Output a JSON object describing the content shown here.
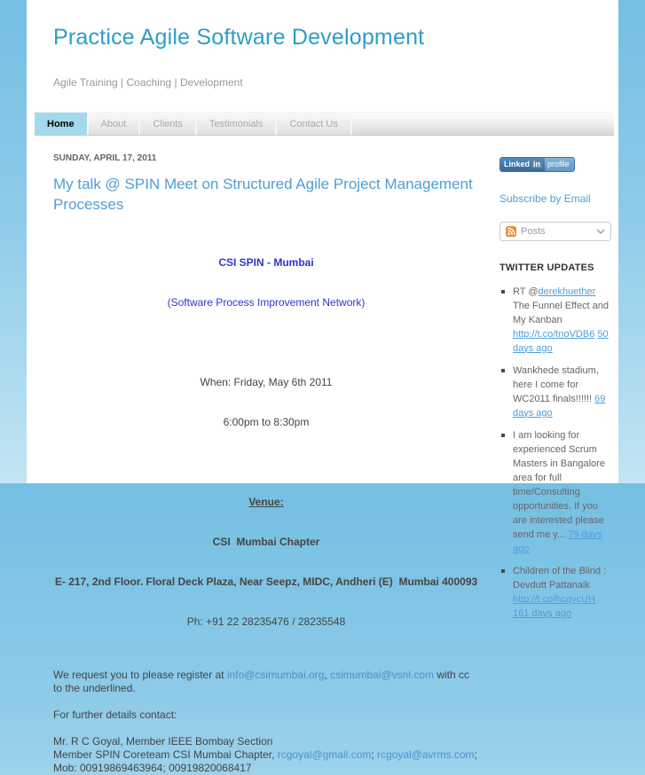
{
  "colors": {
    "page-bg-top": "#74bfe2",
    "page-bg-bottom": "#c2e5f3",
    "header-title": "#2f9dc8",
    "post-title": "#4d9fd6",
    "royal-blue": "#3036c9",
    "link-blue": "#4d8fd1",
    "sidebar-link": "#4f9fd9",
    "tab-active-bg": "#a3d9ec",
    "text-dark": "#444444",
    "text-gray": "#666666",
    "muted": "#999999",
    "rss-orange": "#e98b38"
  },
  "header": {
    "title": "Practice Agile Software Development",
    "subtitle": "Agile Training | Coaching | Development"
  },
  "nav": {
    "tabs": [
      {
        "label": "Home",
        "active": true
      },
      {
        "label": "About",
        "active": false
      },
      {
        "label": "Clients",
        "active": false
      },
      {
        "label": "Testimonials",
        "active": false
      },
      {
        "label": "Contact Us",
        "active": false
      }
    ]
  },
  "post": {
    "date": "SUNDAY, APRIL 17, 2011",
    "title": "My talk @ SPIN Meet on Structured Agile Project Management Processes",
    "event": {
      "org": "CSI SPIN - Mumbai",
      "org_full": "(Software Process Improvement Network)",
      "when_line1": "When: Friday, May 6th 2011",
      "when_line2": "6:00pm to 8:30pm",
      "venue_label": "Venue:",
      "venue_name": "CSI  Mumbai Chapter",
      "venue_address": "E- 217, 2nd Floor. Floral Deck Plaza, Near Seepz, MIDC, Andheri (E)  Mumbai 400093",
      "venue_phone": "Ph: +91 22 28235476 / 28235548"
    },
    "register": {
      "before": "We request you to please register at ",
      "email1": "info@csimumbai.org",
      "sep": ", ",
      "email2": "csimumbai@vsnl.com",
      "after": " with cc to the underlined."
    },
    "contact": {
      "intro": "For further details contact:",
      "line1": "Mr. R C Goyal, Member IEEE Bombay Section",
      "line2_before": "Member SPIN Coreteam CSI Mumbai Chapter, ",
      "line2_email1": "rcgoyal@gmail.com",
      "line2_sep": "; ",
      "line2_email2": "rcgoyal@avrms.com",
      "line2_after": ";",
      "line3": "Mob: 00919869463964; 00919820068417"
    }
  },
  "sidebar": {
    "linkedin_badge": {
      "linked": "Linked",
      "in": "in",
      "profile": "profile"
    },
    "subscribe_label": "Subscribe by Email",
    "feed_dropdown": {
      "selected": "Posts",
      "icon": "rss-icon",
      "chevron": "chevron-down-icon"
    },
    "twitter": {
      "heading": "TWITTER UPDATES",
      "tweets": [
        {
          "segments": [
            {
              "text": "RT @"
            },
            {
              "link": "derekhuether"
            },
            {
              "text": " The Funnel Effect and My Kanban "
            },
            {
              "link": "http://t.co/tnoVDB6"
            },
            {
              "text": " "
            },
            {
              "link": "50 days ago"
            }
          ]
        },
        {
          "segments": [
            {
              "text": "Wankhede stadium, here I come for WC2011 finals!!!!!! "
            },
            {
              "link": "69 days ago"
            }
          ]
        },
        {
          "segments": [
            {
              "text": "I am looking for experienced Scrum Masters in Bangalore area for full time/Consulting opportunities. If you are interested please send me y... "
            },
            {
              "link": "79 days ago"
            }
          ]
        },
        {
          "segments": [
            {
              "text": "Children of the Blind : Devdutt Pattanaik "
            },
            {
              "link": "http://t.co/hcqvcUH"
            },
            {
              "text": " "
            },
            {
              "link": "161 days ago"
            }
          ]
        }
      ]
    }
  }
}
